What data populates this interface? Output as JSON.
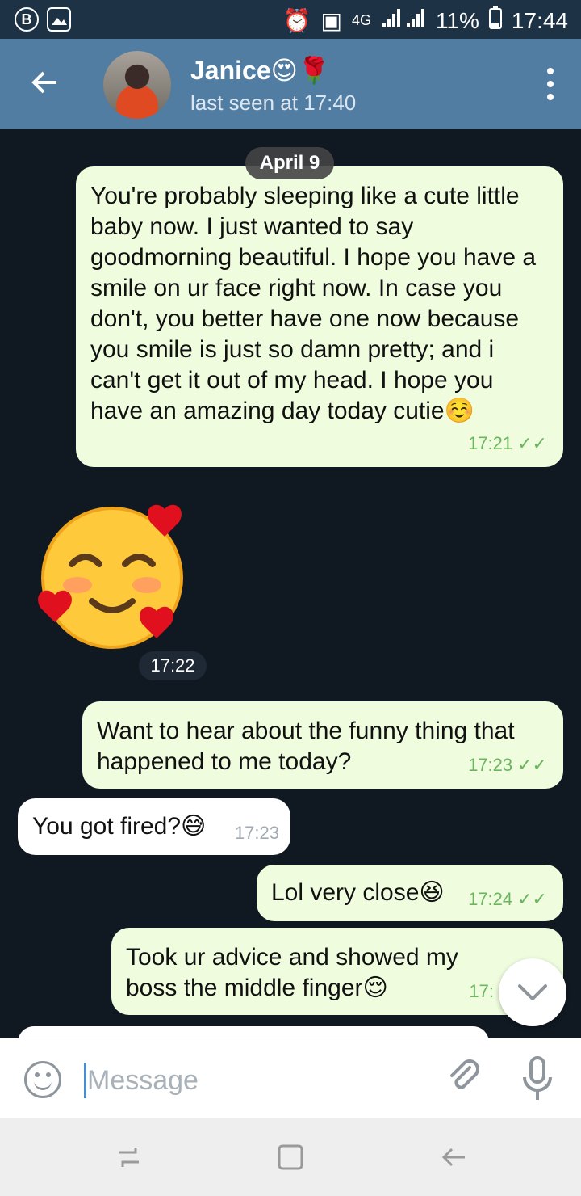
{
  "status_bar": {
    "left_icons": [
      "b-icon",
      "image-icon"
    ],
    "network": "4G",
    "battery": "11%",
    "time": "17:44"
  },
  "header": {
    "contact_name": "Janice😍🌹",
    "last_seen": "last seen at 17:40"
  },
  "chat": {
    "date_label": "April 9",
    "messages": [
      {
        "direction": "out",
        "text": "You're probably sleeping like a cute little baby now. I just wanted to say goodmorning beautiful. I hope you have a smile on ur face right now. In case you don't, you better have one now because you smile is just so damn pretty; and i can't get it out of my head. I hope you have an amazing day today cutie☺️",
        "time": "17:21"
      },
      {
        "direction": "sticker",
        "time": "17:22"
      },
      {
        "direction": "out",
        "text": "Want to hear about the funny thing that happened to me today?",
        "time": "17:23"
      },
      {
        "direction": "in",
        "text": "You got fired?😅",
        "time": "17:23"
      },
      {
        "direction": "out",
        "text": "Lol very close😆",
        "time": "17:24"
      },
      {
        "direction": "out",
        "text": "Took ur advice and showed my boss the middle finger😌",
        "time": "17:"
      }
    ]
  },
  "composer": {
    "placeholder": "Message"
  },
  "colors": {
    "header_bg": "#517da2",
    "outgoing_bubble": "#effdde",
    "incoming_bubble": "#ffffff",
    "read_check": "#6cb55f"
  }
}
